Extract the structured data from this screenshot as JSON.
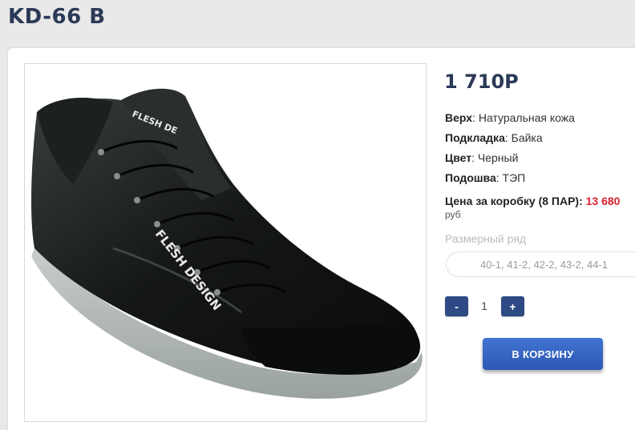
{
  "product": {
    "title": "KD-66 B",
    "price": "1 710Р",
    "attributes": [
      {
        "label": "Верх",
        "value": ": Натуральная кожа"
      },
      {
        "label": "Подкладка",
        "value": ": Байка"
      },
      {
        "label": "Цвет",
        "value": ": Черный"
      },
      {
        "label": "Подошва",
        "value": ": ТЭП"
      }
    ],
    "box_price_label": "Цена за коробку (8 ПАР): ",
    "box_price_value": "13 680",
    "currency": "руб",
    "size_label": "Размерный ряд",
    "size_value": "40-1, 41-2, 42-2, 43-2, 44-1",
    "image_brand_text_1": "FLESH DESIGN",
    "image_brand_text_2": "FLESH DE"
  },
  "cart": {
    "minus_label": "-",
    "plus_label": "+",
    "quantity": "1",
    "add_label": "В КОРЗИНУ"
  },
  "colors": {
    "accent": "#2e4a85",
    "price_red": "#d9212c",
    "title": "#2b3a57"
  }
}
